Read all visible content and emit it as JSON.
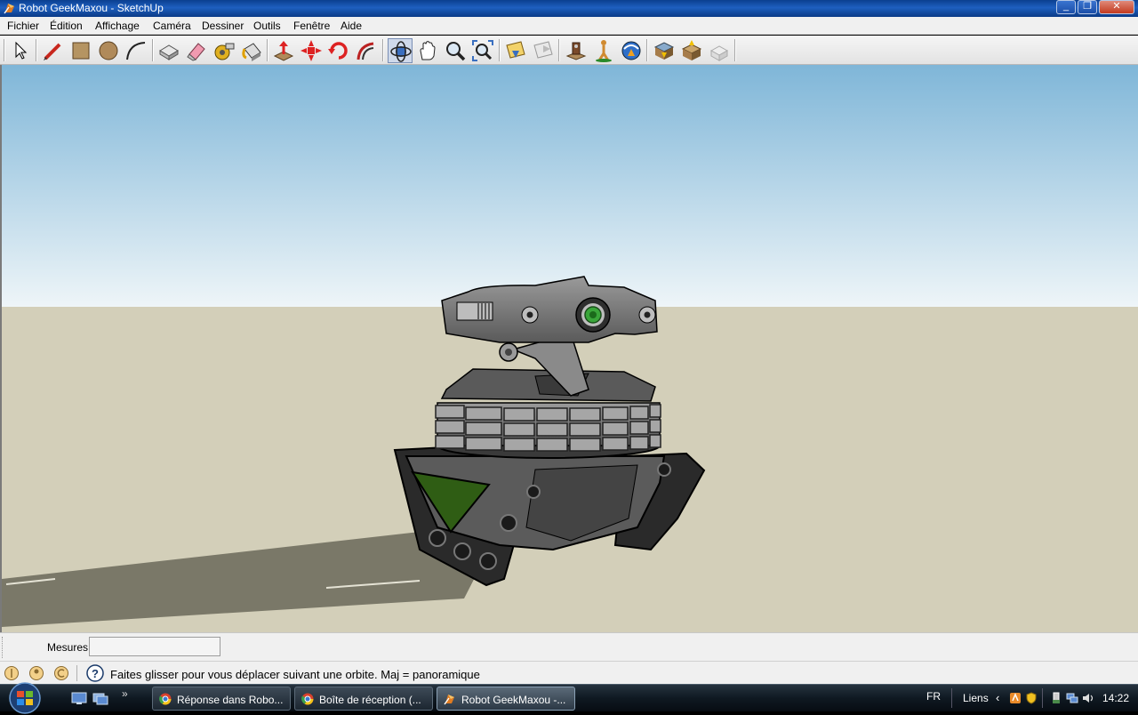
{
  "window": {
    "title": "Robot GeekMaxou - SketchUp",
    "controls": [
      "_",
      "❐",
      "✕"
    ]
  },
  "menu": [
    "Fichier",
    "Édition",
    "Affichage",
    "Caméra",
    "Dessiner",
    "Outils",
    "Fenêtre",
    "Aide"
  ],
  "toolbar": {
    "tools": [
      "select-icon",
      "pencil-icon",
      "rectangle-icon",
      "circle-icon",
      "arc-icon",
      "make-component-icon",
      "eraser-icon",
      "tape-measure-icon",
      "paint-bucket-icon",
      "push-pull-icon",
      "move-icon",
      "rotate-icon",
      "follow-me-icon",
      "orbit-icon",
      "pan-icon",
      "zoom-icon",
      "zoom-extents-icon",
      "previous-view-icon",
      "next-view-icon",
      "position-camera-icon",
      "walk-icon",
      "look-around-icon",
      "get-models-icon",
      "share-model-icon",
      "share-component-icon"
    ]
  },
  "measures": {
    "label": "Mesures",
    "value": ""
  },
  "status": {
    "text": "Faites glisser pour vous déplacer suivant une orbite.  Maj = panoramique"
  },
  "taskbar": {
    "more": "»",
    "tasks": [
      {
        "label": "Réponse dans Robo...",
        "icon": "chrome-icon",
        "active": false
      },
      {
        "label": "Boîte de réception (...",
        "icon": "chrome-icon",
        "active": false
      },
      {
        "label": "Robot GeekMaxou -...",
        "icon": "sketchup-icon",
        "active": true
      }
    ],
    "language": "FR",
    "links": "Liens",
    "clock": "14:22"
  },
  "colors": {
    "sky_top": "#7fb6d8",
    "sky_bottom": "#e8f2f7",
    "ground": "#d3cfb9",
    "shadow": "#7a7868",
    "robot_body": "#7c7c7c",
    "robot_dark": "#2e2e2e",
    "lens_green": "#3aa63a",
    "panel_green": "#2f5d14"
  }
}
